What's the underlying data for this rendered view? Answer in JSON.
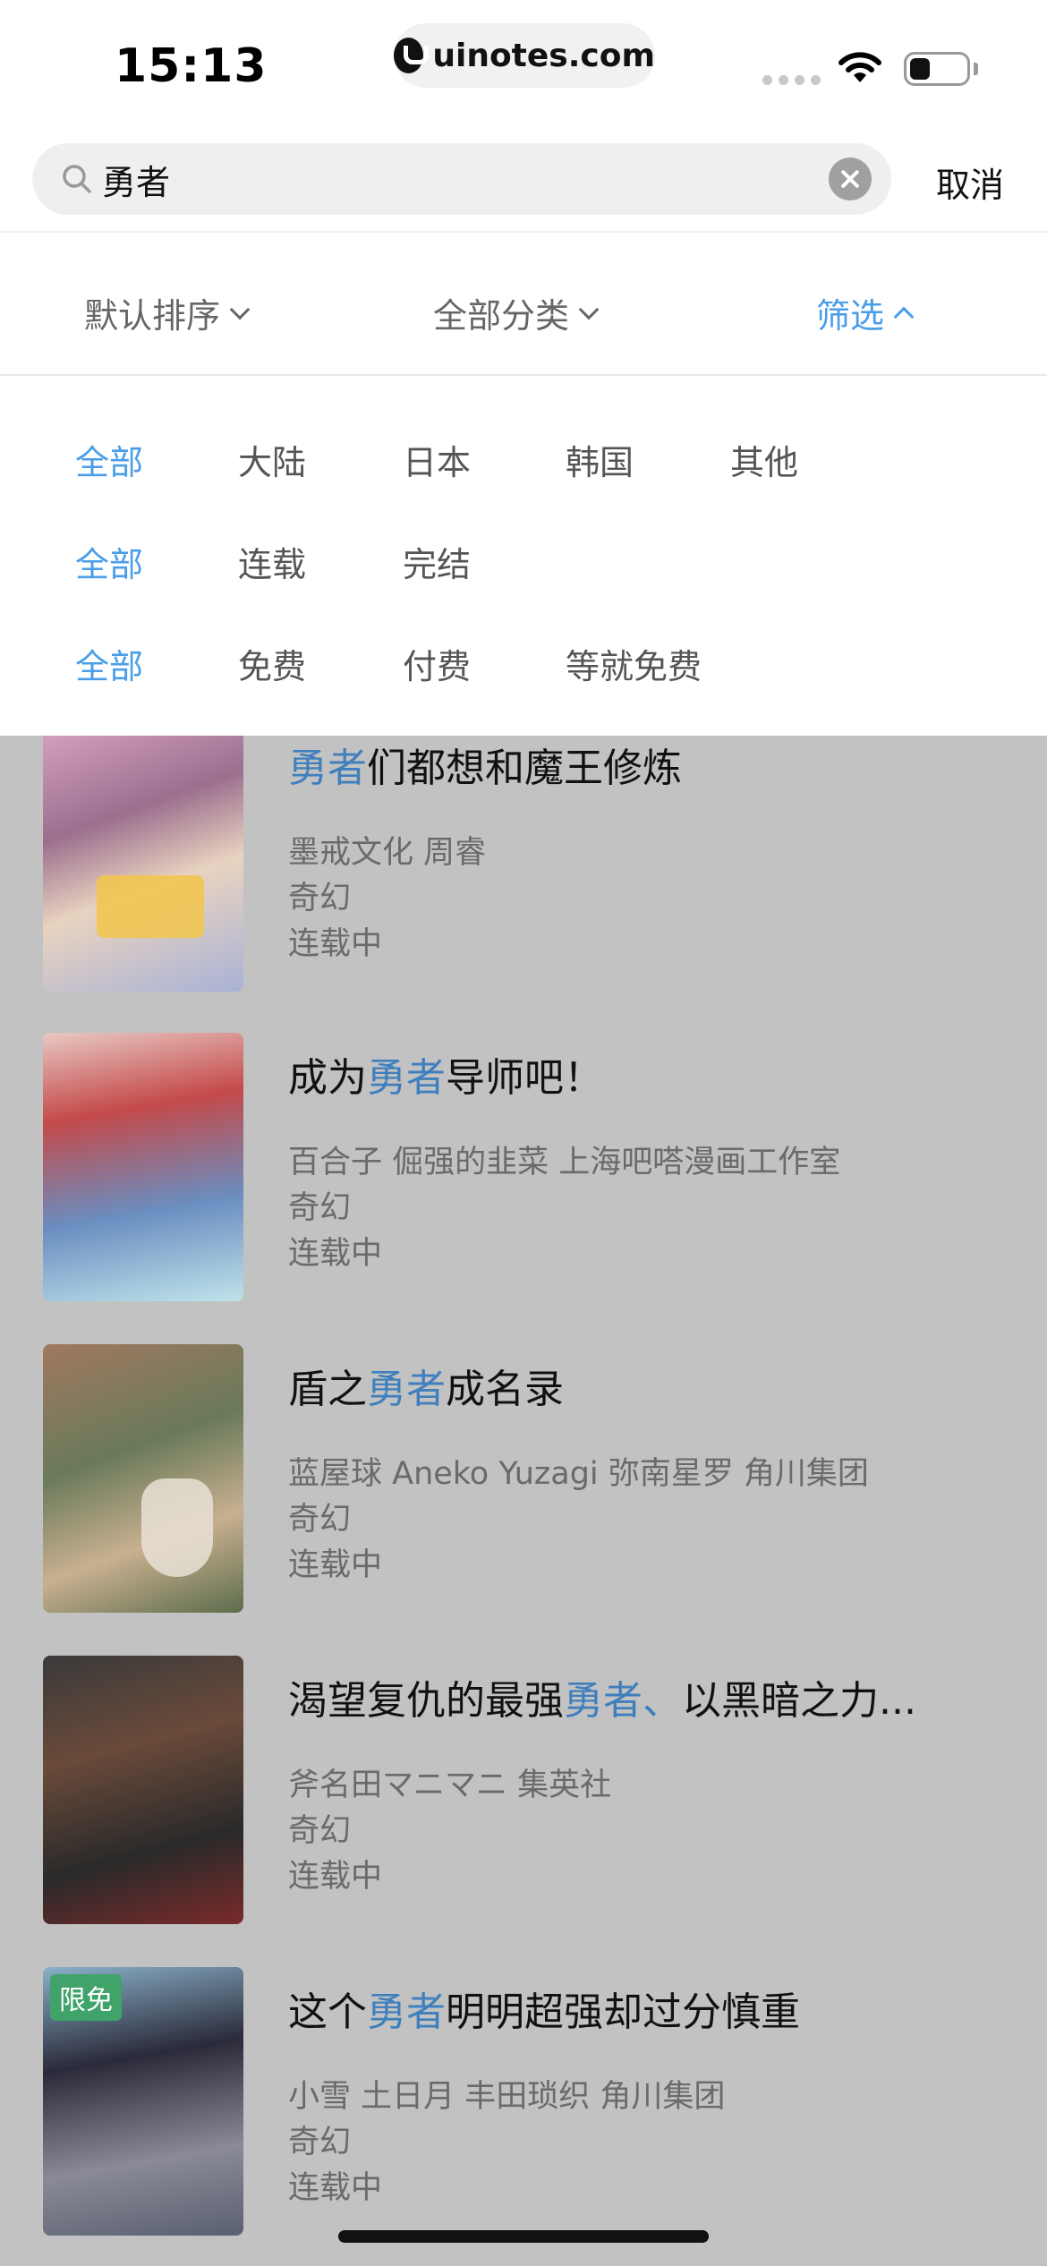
{
  "status_bar": {
    "time": "15:13",
    "url": "uinotes.com"
  },
  "search": {
    "query": "勇者",
    "cancel_label": "取消"
  },
  "sort_tabs": [
    {
      "label": "默认排序",
      "active": false
    },
    {
      "label": "全部分类",
      "active": false
    },
    {
      "label": "筛选",
      "active": true
    }
  ],
  "filters": {
    "region": [
      "全部",
      "大陆",
      "日本",
      "韩国",
      "其他"
    ],
    "status": [
      "全部",
      "连载",
      "完结"
    ],
    "pricing": [
      "全部",
      "免费",
      "付费",
      "等就免费"
    ]
  },
  "results": [
    {
      "title_pre": "",
      "title_hl": "勇者",
      "title_post": "们都想和魔王修炼",
      "authors": "墨戒文化 周睿",
      "genre": "奇幻",
      "status": "连载中",
      "badge": ""
    },
    {
      "title_pre": "成为",
      "title_hl": "勇者",
      "title_post": "导师吧！",
      "authors": "百合子 倔强的韭菜 上海吧嗒漫画工作室",
      "genre": "奇幻",
      "status": "连载中",
      "badge": ""
    },
    {
      "title_pre": "盾之",
      "title_hl": "勇者",
      "title_post": "成名录",
      "authors": "蓝屋球 Aneko Yuzagi 弥南星罗 角川集团",
      "genre": "奇幻",
      "status": "连载中",
      "badge": ""
    },
    {
      "title_pre": "渴望复仇的最强",
      "title_hl": "勇者、",
      "title_post": "以黑暗之力...",
      "authors": "斧名田マニマニ 集英社",
      "genre": "奇幻",
      "status": "连载中",
      "badge": ""
    },
    {
      "title_pre": "这个",
      "title_hl": "勇者",
      "title_post": "明明超强却过分慎重",
      "authors": "小雪 土日月 丰田琐织 角川集团",
      "genre": "奇幻",
      "status": "连载中",
      "badge": "限免"
    }
  ],
  "colors": {
    "accent": "#4a9ee8",
    "overlay": "#c2c2c2",
    "badge": "#3fa36a"
  }
}
